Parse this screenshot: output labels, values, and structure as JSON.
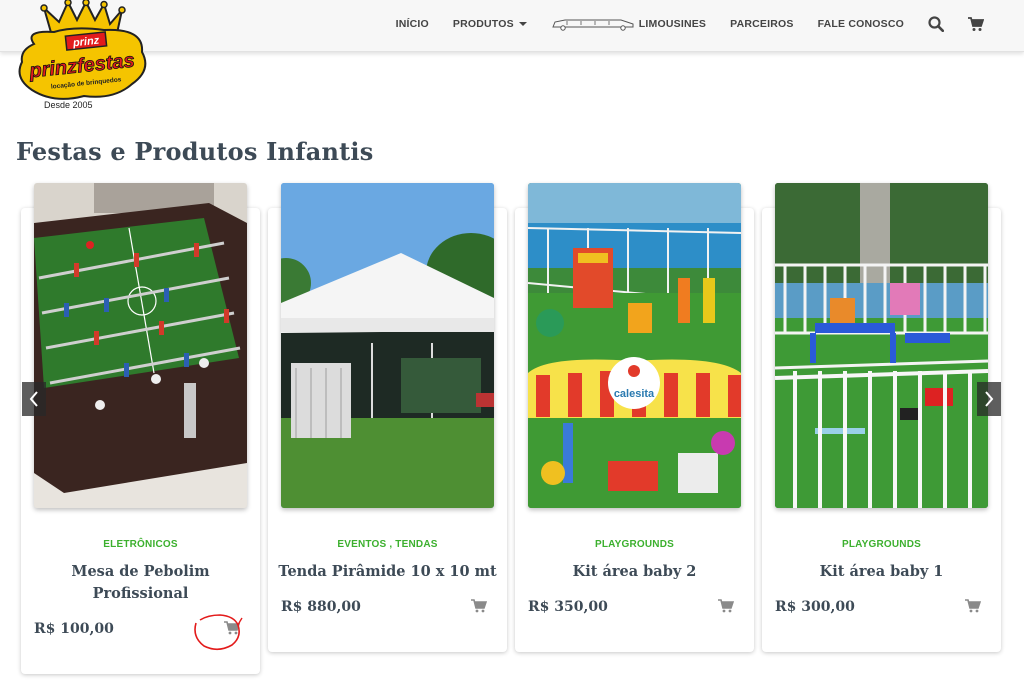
{
  "logo": {
    "brand_top": "prinz",
    "brand_main": "prinzfestas",
    "brand_sub": "locação de brinquedos",
    "tagline": "Desde 2005"
  },
  "nav": {
    "items": [
      {
        "label": "INÍCIO"
      },
      {
        "label": "PRODUTOS"
      },
      {
        "label": "LIMOUSINES"
      },
      {
        "label": "PARCEIROS"
      },
      {
        "label": "FALE CONOSCO"
      }
    ]
  },
  "page": {
    "heading": "Festas e Produtos Infantis"
  },
  "products": [
    {
      "category": "ELETRÔNICOS",
      "title": "Mesa de Pebolim Profissional",
      "price": "R$ 100,00"
    },
    {
      "category": "EVENTOS , TENDAS",
      "title": "Tenda Pirâmide 10 x 10 mt",
      "price": "R$ 880,00"
    },
    {
      "category": "PLAYGROUNDS",
      "title": "Kit área baby 2",
      "price": "R$ 350,00"
    },
    {
      "category": "PLAYGROUNDS",
      "title": "Kit área baby 1",
      "price": "R$ 300,00"
    }
  ],
  "colors": {
    "accent_green": "#3cb02e",
    "heading": "#3d4a56",
    "annotation_red": "#e31b1b"
  },
  "icons": {
    "search": "search-icon",
    "cart": "cart-icon",
    "limo": "limousine-icon",
    "prev": "chevron-left-icon",
    "next": "chevron-right-icon"
  }
}
